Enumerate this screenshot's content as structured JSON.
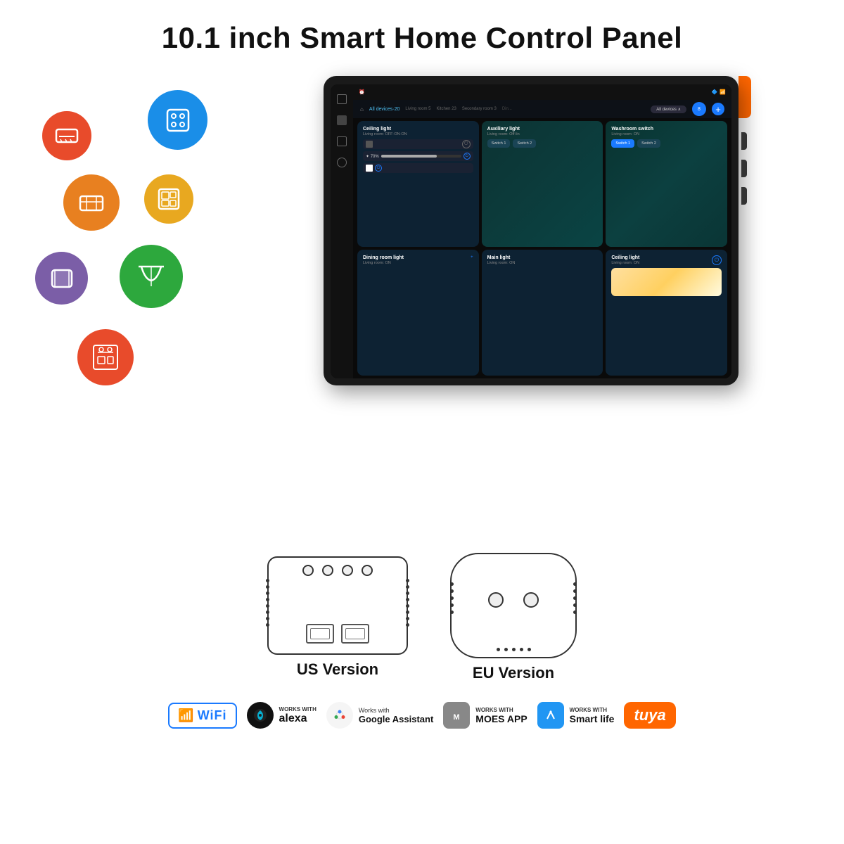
{
  "title": "10.1 inch Smart Home Control Panel",
  "left_icons": [
    {
      "name": "ac-icon",
      "symbol": "❄",
      "class": "ic-ac"
    },
    {
      "name": "switch3-icon",
      "symbol": "⠿",
      "class": "ic-switch3"
    },
    {
      "name": "panel-icon",
      "symbol": "▦",
      "class": "ic-panel"
    },
    {
      "name": "scene-icon",
      "symbol": "⊞",
      "class": "ic-scene"
    },
    {
      "name": "blind-icon",
      "symbol": "▬",
      "class": "ic-blind"
    },
    {
      "name": "curtain-icon",
      "symbol": "▬▬",
      "class": "ic-curtain"
    },
    {
      "name": "circuit-icon",
      "symbol": "⬛",
      "class": "ic-circuit"
    }
  ],
  "tablet": {
    "nav_title": "All devices·20",
    "tabs": [
      "Living room 5",
      "Kitchen 23",
      "Secondary room 3",
      "Din..."
    ],
    "filter_label": "All devices",
    "cards": [
      {
        "title": "Ceiling light",
        "subtitle": "Living room: OFF·ON·ON",
        "type": "controls"
      },
      {
        "title": "Auxiliary light",
        "subtitle": "Living room: Off-lin",
        "type": "teal"
      },
      {
        "title": "Washroom switch",
        "subtitle": "Living room: ON",
        "type": "teal2"
      },
      {
        "title": "Dining room light",
        "subtitle": "Living room: ON",
        "type": "dark"
      },
      {
        "title": "Main light",
        "subtitle": "Living room: ON",
        "type": "dark"
      },
      {
        "title": "Ceiling light",
        "subtitle": "Living room: ON",
        "type": "warm"
      }
    ]
  },
  "versions": {
    "us": {
      "label": "US Version"
    },
    "eu": {
      "label": "EU Version"
    }
  },
  "compat": {
    "wifi_label": "WiFi",
    "alexa_works": "WORKS WITH",
    "alexa_name": "alexa",
    "google_works": "Works with",
    "google_name": "Google Assistant",
    "moes_works": "WORKS WITH",
    "moes_name": "MOES APP",
    "smartlife_works": "WORKS WITH",
    "smartlife_name": "Smart life",
    "tuya_name": "tuya"
  }
}
